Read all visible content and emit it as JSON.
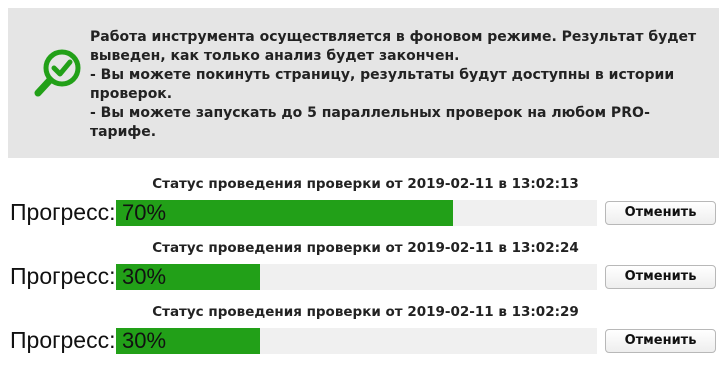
{
  "info": {
    "icon": "magnifier-check-icon",
    "accent_color": "#22a018",
    "line1": "Работа инструмента осуществляется в фоновом режиме. Результат будет выведен, как только анализ будет закончен.",
    "line2": "- Вы можете покинуть страницу, результаты будут доступны в истории проверок.",
    "line3": "- Вы можете запускать до 5 параллельных проверок на любом PRO-тарифе."
  },
  "progress_color": "#22a018",
  "jobs": [
    {
      "status": "Статус проведения проверки от 2019-02-11 в 13:02:13",
      "progress_label": "Прогресс:",
      "progress_percent": 70,
      "progress_text": "70%",
      "cancel_label": "Отменить"
    },
    {
      "status": "Статус проведения проверки от 2019-02-11 в 13:02:24",
      "progress_label": "Прогресс:",
      "progress_percent": 30,
      "progress_text": "30%",
      "cancel_label": "Отменить"
    },
    {
      "status": "Статус проведения проверки от 2019-02-11 в 13:02:29",
      "progress_label": "Прогресс:",
      "progress_percent": 30,
      "progress_text": "30%",
      "cancel_label": "Отменить"
    }
  ]
}
